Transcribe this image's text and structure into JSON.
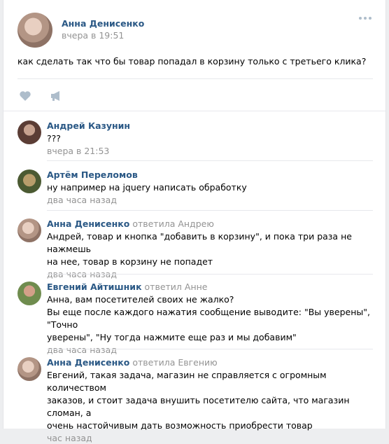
{
  "post": {
    "author": "Анна Денисенко",
    "time": "вчера в 19:51",
    "text": "как сделать так что бы товар попадал в корзину только с третьего клика?"
  },
  "icons": {
    "more": "more-dots-icon",
    "like": "heart-icon",
    "share": "megaphone-icon"
  },
  "colors": {
    "link": "#2a5885",
    "meta": "#939393",
    "icon": "#aebdcb"
  },
  "comments": [
    {
      "author": "Андрей Казунин",
      "reply": "",
      "lines": [
        "???"
      ],
      "time": "вчера в 21:53"
    },
    {
      "author": "Артём Переломов",
      "reply": "",
      "lines": [
        "ну например на jquery написать обработку"
      ],
      "time": "два часа назад"
    },
    {
      "author": "Анна Денисенко",
      "reply": "ответила Андрею",
      "lines": [
        "Андрей, товар и кнопка \"добавить в корзину\", и пока три раза не нажмешь",
        "на нее, товар в корзину не попадет"
      ],
      "time": "два часа назад"
    },
    {
      "author": "Евгений Айтишник",
      "reply": "ответил Анне",
      "lines": [
        "Анна, вам посетителей своих не жалко?",
        "Вы еще после каждого нажатия сообщение выводите: \"Вы уверены\", \"Точно",
        "уверены\", \"Ну тогда нажмите еще раз и мы добавим\""
      ],
      "time": "два часа назад"
    },
    {
      "author": "Анна Денисенко",
      "reply": "ответила Евгению",
      "lines": [
        "Евгений, такая задача, магазин не справляется с огромным количеством",
        "заказов, и стоит задача внушить посетителю сайта, что магазин сломан, а",
        "очень настойчивым дать возможность приобрести товар"
      ],
      "time": "час назад"
    }
  ]
}
